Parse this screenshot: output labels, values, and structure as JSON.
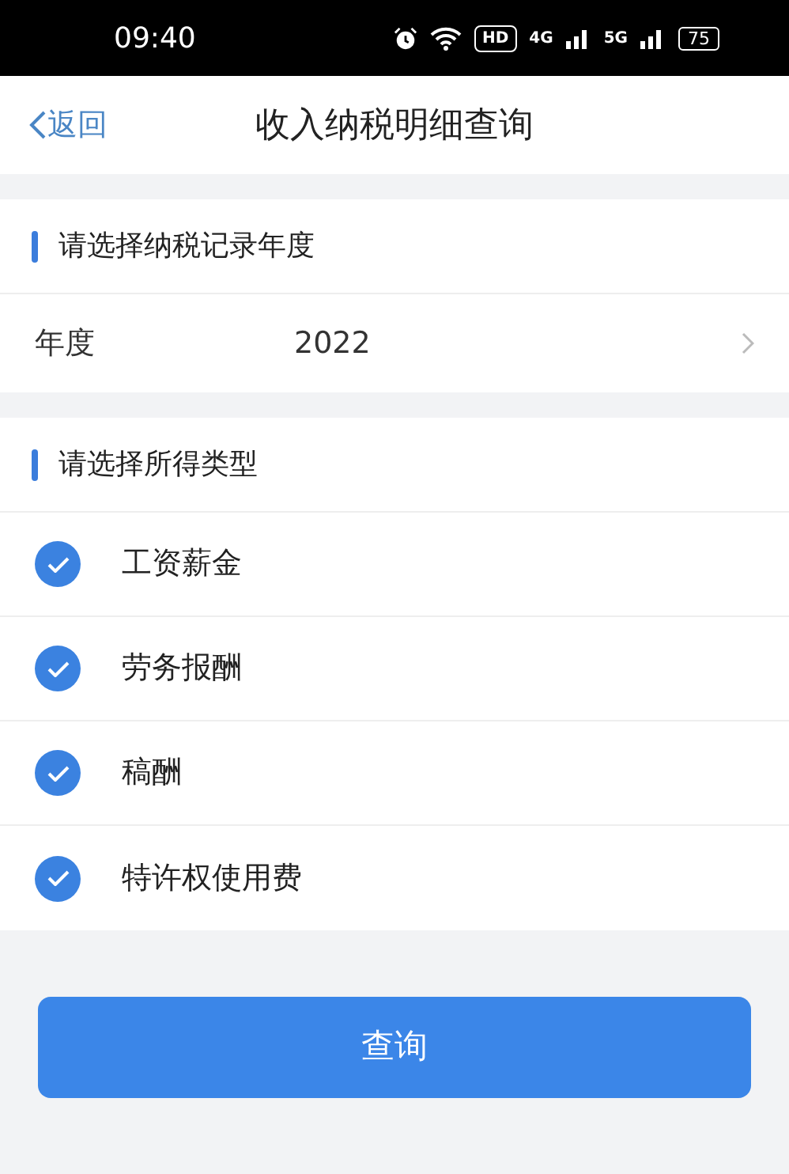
{
  "status_bar": {
    "time": "09:40",
    "hd": "HD",
    "networks": [
      "4G",
      "5G"
    ],
    "battery": "75"
  },
  "nav": {
    "back": "返回",
    "title": "收入纳税明细查询"
  },
  "year_section": {
    "heading": "请选择纳税记录年度",
    "label": "年度",
    "value": "2022"
  },
  "income_section": {
    "heading": "请选择所得类型",
    "items": [
      {
        "label": "工资薪金",
        "checked": true
      },
      {
        "label": "劳务报酬",
        "checked": true
      },
      {
        "label": "稿酬",
        "checked": true
      },
      {
        "label": "特许权使用费",
        "checked": true
      }
    ]
  },
  "submit": "查询"
}
